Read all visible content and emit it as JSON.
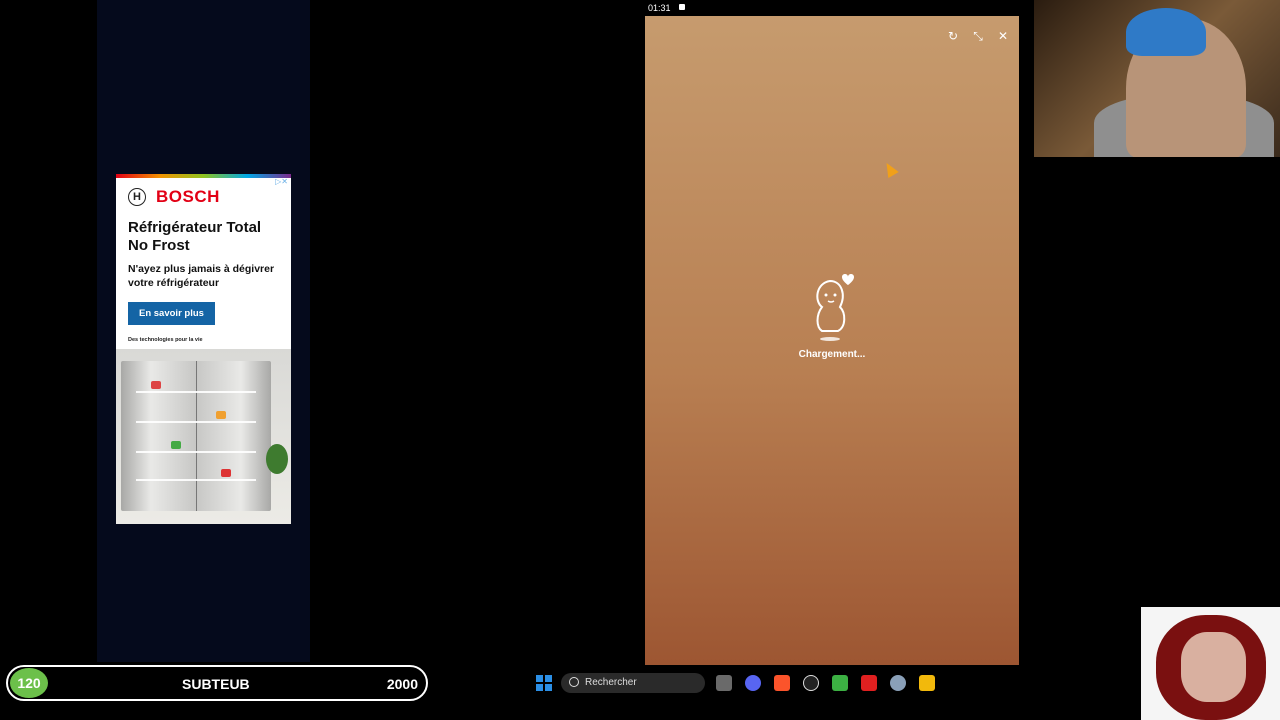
{
  "ad": {
    "brand": "BOSCH",
    "title": "Réfrigérateur Total No Frost",
    "subtitle": "N'ayez plus jamais à dégivrer votre réfrigérateur",
    "cta": "En savoir plus",
    "tagline": "Des technologies pour la vie"
  },
  "status": {
    "time": "01:31"
  },
  "popup": {
    "loading_text": "Chargement..."
  },
  "scoreboard": {
    "count": "120",
    "name": "SUBTEUB",
    "target": "2000"
  },
  "taskbar": {
    "search_placeholder": "Rechercher"
  },
  "colors": {
    "accent_green": "#6cc04a",
    "popup_top": "#c69b6e",
    "popup_bottom": "#9d5632",
    "bosch_red": "#e20015",
    "cta_blue": "#1464a5"
  },
  "icons": [
    "windows-start-icon",
    "search-icon",
    "file-explorer-icon",
    "discord-icon",
    "brave-browser-icon",
    "obs-icon",
    "spreadsheet-icon",
    "youtube-icon",
    "settings-icon",
    "chrome-icon"
  ]
}
